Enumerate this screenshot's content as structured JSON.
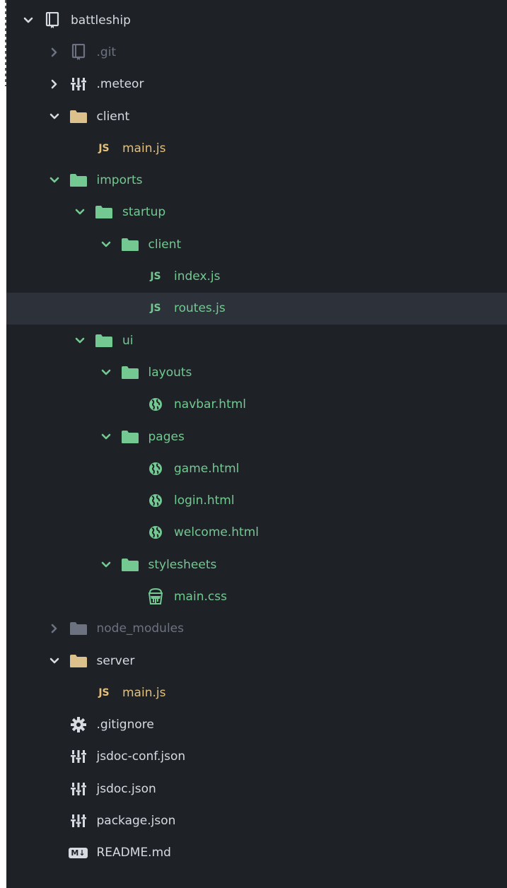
{
  "colors": {
    "background": "#1e2227",
    "selected_row": "#2c313a",
    "text_default": "#d6dbe2",
    "text_ignored": "#6c7280",
    "text_added": "#73c991",
    "text_modified": "#e5c07b",
    "folder_default": "#dcc18c",
    "folder_added": "#73c991",
    "folder_ignored": "#6c7280"
  },
  "tree": [
    {
      "name": "battleship",
      "icon": "repo-icon",
      "chevron": "down",
      "depth": 0,
      "status": "default"
    },
    {
      "name": ".git",
      "icon": "repo-icon",
      "chevron": "right",
      "depth": 1,
      "status": "ignored"
    },
    {
      "name": ".meteor",
      "icon": "settings-file-icon",
      "chevron": "right",
      "depth": 1,
      "status": "default"
    },
    {
      "name": "client",
      "icon": "folder-icon",
      "chevron": "down",
      "depth": 1,
      "status": "default"
    },
    {
      "name": "main.js",
      "icon": "js-file-icon",
      "chevron": "none",
      "depth": 2,
      "status": "modified"
    },
    {
      "name": "imports",
      "icon": "folder-icon",
      "chevron": "down",
      "depth": 1,
      "status": "added"
    },
    {
      "name": "startup",
      "icon": "folder-icon",
      "chevron": "down",
      "depth": 2,
      "status": "added"
    },
    {
      "name": "client",
      "icon": "folder-icon",
      "chevron": "down",
      "depth": 3,
      "status": "added"
    },
    {
      "name": "index.js",
      "icon": "js-file-icon",
      "chevron": "none",
      "depth": 4,
      "status": "added"
    },
    {
      "name": "routes.js",
      "icon": "js-file-icon",
      "chevron": "none",
      "depth": 4,
      "status": "added",
      "selected": true
    },
    {
      "name": "ui",
      "icon": "folder-icon",
      "chevron": "down",
      "depth": 2,
      "status": "added"
    },
    {
      "name": "layouts",
      "icon": "folder-icon",
      "chevron": "down",
      "depth": 3,
      "status": "added"
    },
    {
      "name": "navbar.html",
      "icon": "globe-icon",
      "chevron": "none",
      "depth": 4,
      "status": "added"
    },
    {
      "name": "pages",
      "icon": "folder-icon",
      "chevron": "down",
      "depth": 3,
      "status": "added"
    },
    {
      "name": "game.html",
      "icon": "globe-icon",
      "chevron": "none",
      "depth": 4,
      "status": "added"
    },
    {
      "name": "login.html",
      "icon": "globe-icon",
      "chevron": "none",
      "depth": 4,
      "status": "added"
    },
    {
      "name": "welcome.html",
      "icon": "globe-icon",
      "chevron": "none",
      "depth": 4,
      "status": "added"
    },
    {
      "name": "stylesheets",
      "icon": "folder-icon",
      "chevron": "down",
      "depth": 3,
      "status": "added"
    },
    {
      "name": "main.css",
      "icon": "css-bucket-icon",
      "chevron": "none",
      "depth": 4,
      "status": "added"
    },
    {
      "name": "node_modules",
      "icon": "folder-icon",
      "chevron": "right",
      "depth": 1,
      "status": "ignored"
    },
    {
      "name": "server",
      "icon": "folder-icon",
      "chevron": "down",
      "depth": 1,
      "status": "default"
    },
    {
      "name": "main.js",
      "icon": "js-file-icon",
      "chevron": "none",
      "depth": 2,
      "status": "modified"
    },
    {
      "name": ".gitignore",
      "icon": "gear-icon",
      "chevron": "none",
      "depth": 1,
      "status": "default"
    },
    {
      "name": "jsdoc-conf.json",
      "icon": "settings-file-icon",
      "chevron": "none",
      "depth": 1,
      "status": "default"
    },
    {
      "name": "jsdoc.json",
      "icon": "settings-file-icon",
      "chevron": "none",
      "depth": 1,
      "status": "default"
    },
    {
      "name": "package.json",
      "icon": "settings-file-icon",
      "chevron": "none",
      "depth": 1,
      "status": "default"
    },
    {
      "name": "README.md",
      "icon": "markdown-icon",
      "chevron": "none",
      "depth": 1,
      "status": "default"
    }
  ],
  "glyphs": {
    "js": "JS",
    "md": "M↓"
  }
}
